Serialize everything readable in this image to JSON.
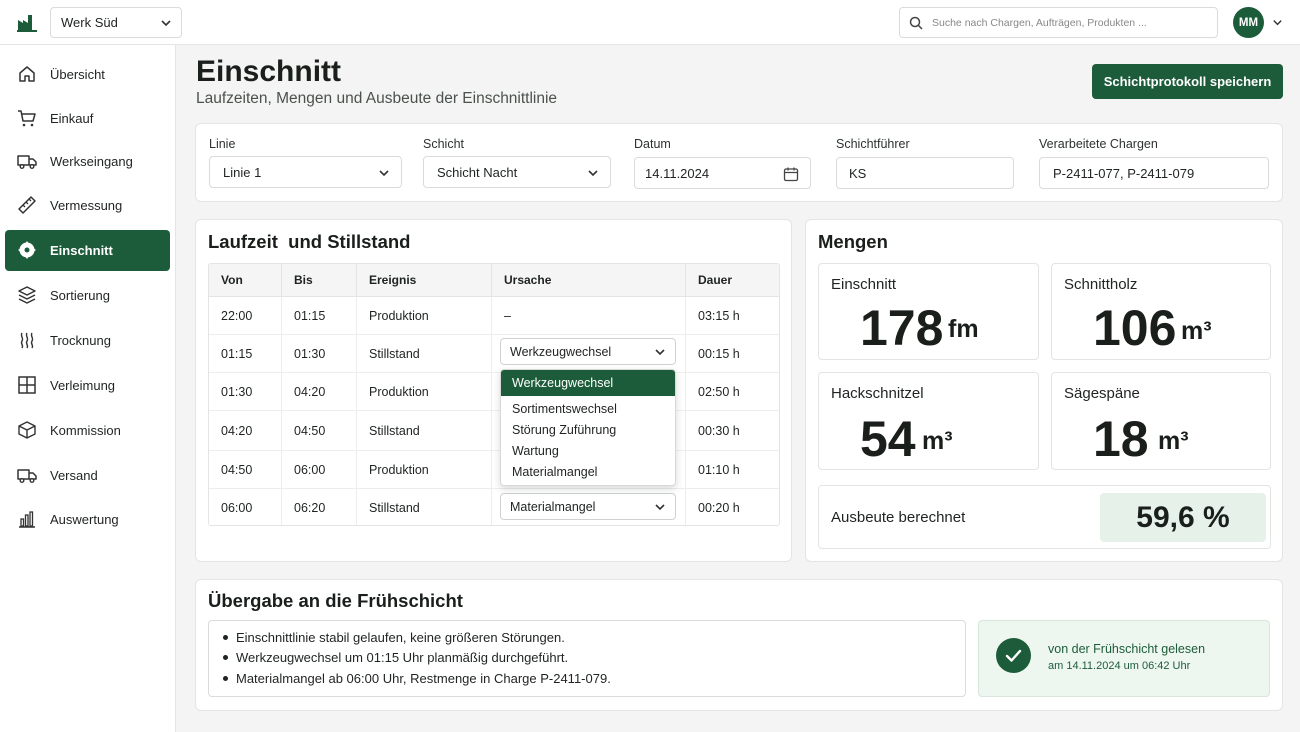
{
  "topbar": {
    "plant": "Werk Süd",
    "search_placeholder": "Suche nach Chargen, Aufträgen, Produkten ...",
    "avatar_initials": "MM"
  },
  "sidebar": {
    "items": [
      {
        "label": "Übersicht",
        "icon": "home-icon"
      },
      {
        "label": "Einkauf",
        "icon": "cart-icon"
      },
      {
        "label": "Werkseingang",
        "icon": "truck-icon"
      },
      {
        "label": "Vermessung",
        "icon": "ruler-icon"
      },
      {
        "label": "Einschnitt",
        "icon": "saw-blade-icon",
        "active": true
      },
      {
        "label": "Sortierung",
        "icon": "layers-icon"
      },
      {
        "label": "Trocknung",
        "icon": "heat-icon"
      },
      {
        "label": "Verleimung",
        "icon": "grid-icon"
      },
      {
        "label": "Kommission",
        "icon": "box-icon"
      },
      {
        "label": "Versand",
        "icon": "delivery-truck-icon"
      },
      {
        "label": "Auswertung",
        "icon": "bar-chart-icon"
      }
    ]
  },
  "header": {
    "title": "Einschnitt",
    "subtitle": "Laufzeiten, Mengen und Ausbeute der Einschnittlinie",
    "save_label": "Schichtprotokoll speichern"
  },
  "filters": {
    "line_label": "Linie",
    "line_value": "Linie 1",
    "shift_label": "Schicht",
    "shift_value": "Schicht Nacht",
    "date_label": "Datum",
    "date_value": "14.11.2024",
    "lead_label": "Schichtführer",
    "lead_value": "KS",
    "batches_label": "Verarbeitete Chargen",
    "batches_value": "P-2411-077, P-2411-079"
  },
  "runtime": {
    "title": "Laufzeit  und Stillstand",
    "columns": [
      "Von",
      "Bis",
      "Ereignis",
      "Ursache",
      "Dauer"
    ],
    "rows": [
      {
        "from": "22:00",
        "to": "01:15",
        "event": "Produktion",
        "cause": "–",
        "duration": "03:15 h"
      },
      {
        "from": "01:15",
        "to": "01:30",
        "event": "Stillstand",
        "cause": "Werkzeugwechsel",
        "duration": "00:15 h"
      },
      {
        "from": "01:30",
        "to": "04:20",
        "event": "Produktion",
        "cause": "",
        "duration": "02:50 h"
      },
      {
        "from": "04:20",
        "to": "04:50",
        "event": "Stillstand",
        "cause": "",
        "duration": "00:30 h"
      },
      {
        "from": "04:50",
        "to": "06:00",
        "event": "Produktion",
        "cause": "",
        "duration": "01:10 h"
      },
      {
        "from": "06:00",
        "to": "06:20",
        "event": "Stillstand",
        "cause": "Materialmangel",
        "duration": "00:20 h"
      }
    ],
    "dropdown_options": [
      "Werkzeugwechsel",
      "Sortimentswechsel",
      "Störung Zuführung",
      "Wartung",
      "Materialmangel"
    ]
  },
  "quantities": {
    "title": "Mengen",
    "tiles": [
      {
        "label": "Einschnitt",
        "value": "178",
        "unit": "fm"
      },
      {
        "label": "Schnittholz",
        "value": "106",
        "unit": "m³"
      },
      {
        "label": "Hackschnitzel",
        "value": "54",
        "unit": "m³"
      },
      {
        "label": "Sägespäne",
        "value": "18",
        "unit": "m³"
      }
    ],
    "yield_label": "Ausbeute berechnet",
    "yield_value": "59,6 %"
  },
  "handover": {
    "title": "Übergabe an die Frühschicht",
    "notes": [
      "Einschnittlinie stabil gelaufen, keine größeren Störungen.",
      "Werkzeugwechsel um 01:15 Uhr planmäßig durchgeführt.",
      "Materialmangel ab 06:00 Uhr, Restmenge in Charge P-2411-079."
    ],
    "ack_title": "von der Frühschicht gelesen",
    "ack_sub": "am 14.11.2024 um 06:42 Uhr"
  },
  "colors": {
    "accent": "#1d5c3a",
    "yield_bg": "#e6f2e9"
  }
}
